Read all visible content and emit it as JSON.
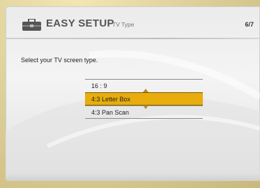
{
  "header": {
    "icon": "toolbox-icon",
    "title": "EASY SETUP",
    "subtitle": "TV Type",
    "step": "6/7"
  },
  "prompt": "Select your TV screen type.",
  "options": [
    {
      "label": "16 : 9",
      "selected": false
    },
    {
      "label": "4:3 Letter Box",
      "selected": true
    },
    {
      "label": "4:3 Pan Scan",
      "selected": false
    }
  ],
  "colors": {
    "highlight": "#e8ad0c",
    "arrow": "#b5882a",
    "frame": "#d9c98f"
  }
}
